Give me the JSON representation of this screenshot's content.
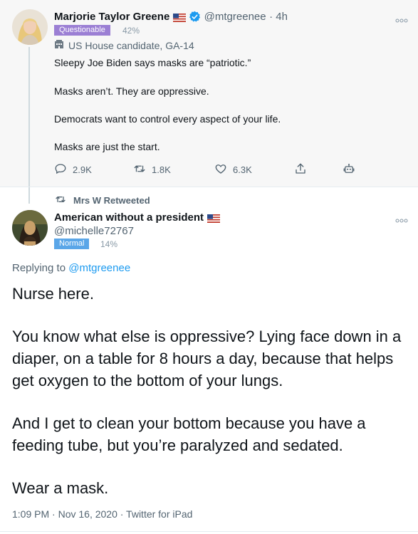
{
  "tweet1": {
    "author_name": "Marjorie Taylor Greene",
    "handle": "@mtgreenee",
    "time": "· 4h",
    "badge": "Questionable",
    "badge_pct": "42%",
    "candidate_label": "US House candidate, GA-14",
    "lines": [
      "Sleepy Joe Biden says masks are “patriotic.”",
      "Masks aren’t. They are oppressive.",
      "Democrats want to control every aspect of your life.",
      "Masks are just the start."
    ],
    "actions": {
      "replies": "2.9K",
      "retweets": "1.8K",
      "likes": "6.3K"
    }
  },
  "retweet_notice": "Mrs W Retweeted",
  "tweet2": {
    "author_name": "American without a president",
    "handle": "@michelle72767",
    "badge": "Normal",
    "badge_pct": "14%",
    "replying_prefix": "Replying to",
    "replying_to": "@mtgreenee",
    "lines": [
      "Nurse here.",
      "You know what else is oppressive? Lying face down in a",
      "diaper, on a table for 8 hours a day, because that helps",
      "get oxygen to the bottom of your lungs.",
      "And I get to clean your bottom because you have a",
      "feeding tube, but you’re paralyzed and sedated.",
      "Wear a mask."
    ],
    "timestamp": "1:09 PM · Nov 16, 2020 · Twitter for iPad"
  },
  "colors": {
    "questionable_badge": "#9b7fd4",
    "normal_badge": "#5aa6e8",
    "verified": "#1d9bf0",
    "link": "#1d9bf0"
  },
  "icons": [
    "us-flag-icon",
    "verified-icon",
    "building-icon",
    "reply-icon",
    "retweet-icon",
    "like-icon",
    "share-icon",
    "robot-icon",
    "more-icon"
  ]
}
